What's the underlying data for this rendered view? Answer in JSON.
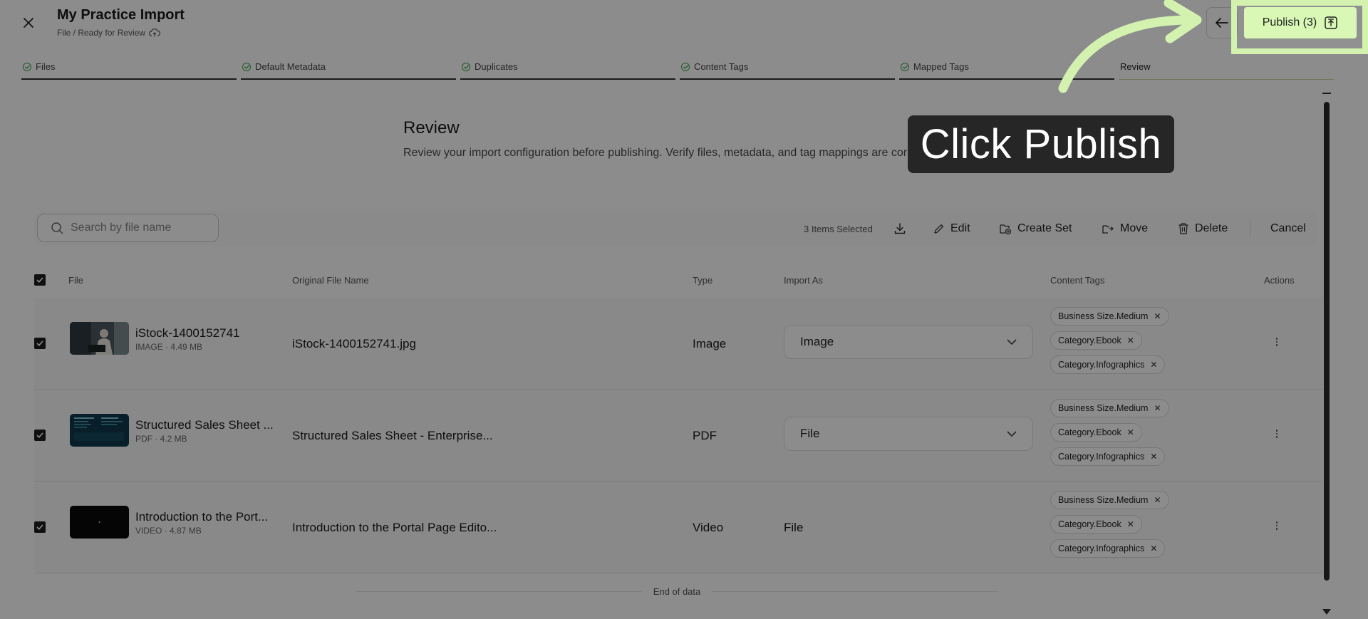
{
  "header": {
    "title": "My Practice Import",
    "breadcrumb": "File / Ready for Review",
    "publish_label": "Publish (3)"
  },
  "steps": [
    {
      "label": "Files",
      "done": true
    },
    {
      "label": "Default Metadata",
      "done": true
    },
    {
      "label": "Duplicates",
      "done": true
    },
    {
      "label": "Content Tags",
      "done": true
    },
    {
      "label": "Mapped Tags",
      "done": true
    },
    {
      "label": "Review",
      "done": false
    }
  ],
  "review": {
    "title": "Review",
    "description": "Review your import configuration before publishing. Verify files, metadata, and tag mappings are correct."
  },
  "toolbar": {
    "search_placeholder": "Search by file name",
    "selected_count": "3 Items Selected",
    "edit": "Edit",
    "create_set": "Create Set",
    "move": "Move",
    "delete": "Delete",
    "cancel": "Cancel"
  },
  "table": {
    "headers": {
      "file": "File",
      "original": "Original File Name",
      "type": "Type",
      "import_as": "Import As",
      "content_tags": "Content Tags",
      "actions": "Actions"
    },
    "rows": [
      {
        "name": "iStock-1400152741",
        "meta": "IMAGE · 4.49 MB",
        "original": "iStock-1400152741.jpg",
        "type": "Image",
        "import_as": "Image",
        "tags": [
          "Business Size.Medium",
          "Category.Ebook",
          "Category.Infographics"
        ]
      },
      {
        "name": "Structured Sales Sheet ...",
        "meta": "PDF · 4.2 MB",
        "original": "Structured Sales Sheet - Enterprise...",
        "type": "PDF",
        "import_as": "File",
        "tags": [
          "Business Size.Medium",
          "Category.Ebook",
          "Category.Infographics"
        ]
      },
      {
        "name": "Introduction to the Port...",
        "meta": "VIDEO · 4.87 MB",
        "original": "Introduction to the Portal Page Edito...",
        "type": "Video",
        "import_as": "File",
        "tags": [
          "Business Size.Medium",
          "Category.Ebook",
          "Category.Infographics"
        ]
      }
    ],
    "end_text": "End of data"
  },
  "overlay": {
    "callout": "Click Publish",
    "highlight_color": "#d3f2b0"
  }
}
